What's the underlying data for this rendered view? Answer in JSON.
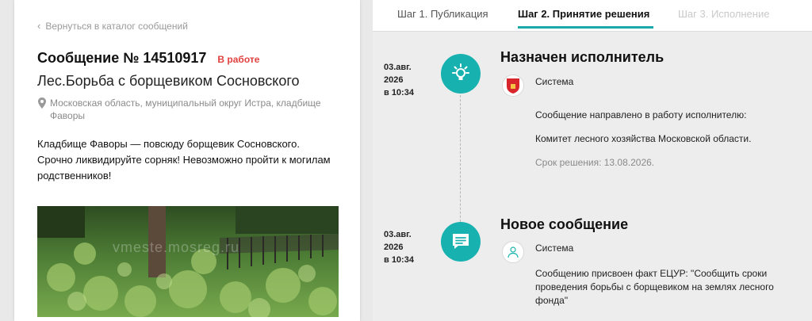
{
  "left": {
    "back_link": "Вернуться в каталог сообщений",
    "message_title": "Сообщение № 14510917",
    "status": "В работе",
    "topic": "Лес.Борьба с борщевиком Сосновского",
    "address": "Московская область, муниципальный округ Истра, кладбище Фаворы",
    "description": "Кладбище Фаворы — повсюду борщевик Сосновского. Срочно ликвидируйте сорняк! Невозможно пройти к могилам родственников!",
    "photo_watermark": "vmeste.mosreg.ru"
  },
  "tabs": [
    {
      "label": "Шаг 1. Публикация"
    },
    {
      "label": "Шаг 2. Принятие решения"
    },
    {
      "label": "Шаг 3. Исполнение"
    }
  ],
  "events": [
    {
      "date_line1": "03.авг.",
      "date_line2": "2026",
      "date_line3": "в 10:34",
      "title": "Назначен исполнитель",
      "author": "Система",
      "text1": "Сообщение направлено в работу исполнителю:",
      "text2": "Комитет лесного хозяйства Московской области.",
      "text3": "Срок решения: 13.08.2026.",
      "icon": "lightbulb-icon"
    },
    {
      "date_line1": "03.авг.",
      "date_line2": "2026",
      "date_line3": "в 10:34",
      "title": "Новое сообщение",
      "author": "Система",
      "text1": "Сообщению присвоен факт ЕЦУР: \"Сообщить сроки проведения борьбы с борщевиком на землях лесного фонда\"",
      "icon": "message-icon"
    }
  ],
  "colors": {
    "accent": "#17b2b0",
    "status": "#e2403f"
  }
}
